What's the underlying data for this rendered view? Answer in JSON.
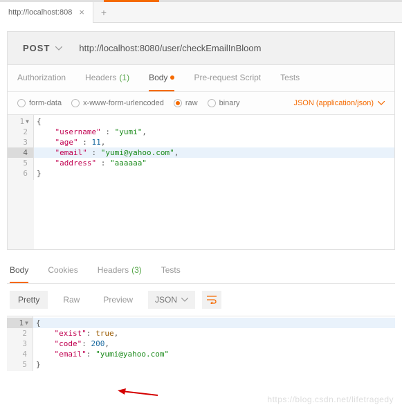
{
  "browser": {
    "tab_title": "http://localhost:808"
  },
  "request": {
    "method": "POST",
    "url": "http://localhost:8080/user/checkEmailInBloom"
  },
  "main_tabs": {
    "authorization": "Authorization",
    "headers": "Headers",
    "headers_count": "(1)",
    "body": "Body",
    "prerequest": "Pre-request Script",
    "tests": "Tests"
  },
  "body_options": {
    "form_data": "form-data",
    "xwww": "x-www-form-urlencoded",
    "raw": "raw",
    "binary": "binary",
    "content_type": "JSON (application/json)"
  },
  "request_body": {
    "lines": [
      {
        "n": "1",
        "fold": true,
        "content": [
          {
            "t": "brace",
            "v": "{"
          }
        ]
      },
      {
        "n": "2",
        "content": [
          {
            "t": "pad",
            "v": "    "
          },
          {
            "t": "key",
            "v": "\"username\""
          },
          {
            "t": "brace",
            "v": " : "
          },
          {
            "t": "str",
            "v": "\"yumi\""
          },
          {
            "t": "brace",
            "v": ","
          }
        ]
      },
      {
        "n": "3",
        "content": [
          {
            "t": "pad",
            "v": "    "
          },
          {
            "t": "key",
            "v": "\"age\""
          },
          {
            "t": "brace",
            "v": " : "
          },
          {
            "t": "num",
            "v": "11"
          },
          {
            "t": "brace",
            "v": ","
          }
        ]
      },
      {
        "n": "4",
        "hl": true,
        "content": [
          {
            "t": "pad",
            "v": "    "
          },
          {
            "t": "key",
            "v": "\"email\""
          },
          {
            "t": "brace",
            "v": " : "
          },
          {
            "t": "str",
            "v": "\"yumi@yahoo.com\""
          },
          {
            "t": "brace",
            "v": ","
          }
        ]
      },
      {
        "n": "5",
        "content": [
          {
            "t": "pad",
            "v": "    "
          },
          {
            "t": "key",
            "v": "\"address\""
          },
          {
            "t": "brace",
            "v": " : "
          },
          {
            "t": "str",
            "v": "\"aaaaaa\""
          }
        ]
      },
      {
        "n": "6",
        "content": [
          {
            "t": "brace",
            "v": "}"
          }
        ]
      }
    ]
  },
  "response_tabs": {
    "body": "Body",
    "cookies": "Cookies",
    "headers": "Headers",
    "headers_count": "(3)",
    "tests": "Tests"
  },
  "response_toolbar": {
    "pretty": "Pretty",
    "raw": "Raw",
    "preview": "Preview",
    "format": "JSON"
  },
  "response_body": {
    "lines": [
      {
        "n": "1",
        "fold": true,
        "hl": true,
        "content": [
          {
            "t": "brace",
            "v": "{"
          }
        ]
      },
      {
        "n": "2",
        "content": [
          {
            "t": "pad",
            "v": "    "
          },
          {
            "t": "key",
            "v": "\"exist\""
          },
          {
            "t": "brace",
            "v": ": "
          },
          {
            "t": "bool",
            "v": "true"
          },
          {
            "t": "brace",
            "v": ","
          }
        ]
      },
      {
        "n": "3",
        "content": [
          {
            "t": "pad",
            "v": "    "
          },
          {
            "t": "key",
            "v": "\"code\""
          },
          {
            "t": "brace",
            "v": ": "
          },
          {
            "t": "num",
            "v": "200"
          },
          {
            "t": "brace",
            "v": ","
          }
        ]
      },
      {
        "n": "4",
        "content": [
          {
            "t": "pad",
            "v": "    "
          },
          {
            "t": "key",
            "v": "\"email\""
          },
          {
            "t": "brace",
            "v": ": "
          },
          {
            "t": "str",
            "v": "\"yumi@yahoo.com\""
          }
        ]
      },
      {
        "n": "5",
        "content": [
          {
            "t": "brace",
            "v": "}"
          }
        ]
      }
    ]
  },
  "watermark": "https://blog.csdn.net/lifetragedy"
}
